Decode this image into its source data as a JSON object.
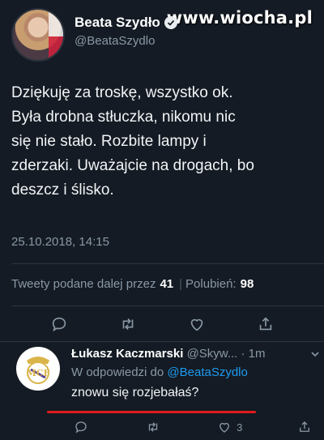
{
  "watermark": "www.wiocha.pl",
  "tweet": {
    "display_name": "Beata Szydło",
    "handle": "@BeataSzydlo",
    "lines": [
      "Dziękuję za troskę, wszystko ok.",
      "Była drobna stłuczka, nikomu nic",
      "się nie stało. Rozbite lampy i",
      "zderzaki. Uważajcie na drogach, bo",
      "deszcz i ślisko."
    ],
    "timestamp": "25.10.2018, 14:15",
    "stats": {
      "retweets_label": "Tweety podane dalej przez",
      "retweets_count": "41",
      "likes_label": "Polubień:",
      "likes_count": "98"
    }
  },
  "reply": {
    "display_name": "Łukasz Kaczmarski",
    "handle": "@Skyw...",
    "time": "· 1m",
    "replying_to_label": "W odpowiedzi do",
    "replying_to_mention": "@BeataSzydlo",
    "text": "znowu się rozjebałaś?",
    "likes_count": "3"
  },
  "icons": [
    "verified-icon",
    "reply-icon",
    "retweet-icon",
    "like-icon",
    "share-icon",
    "chevron-down-icon"
  ],
  "colors": {
    "background": "#141b24",
    "link": "#1d9bf0",
    "muted": "#8a98a6",
    "annotation": "#e01b1b"
  }
}
